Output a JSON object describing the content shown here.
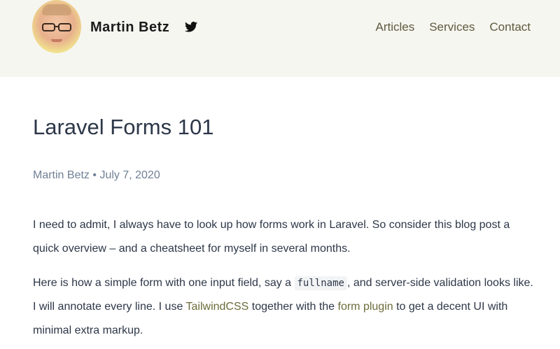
{
  "header": {
    "brand_name": "Martin Betz",
    "nav": [
      {
        "label": "Articles"
      },
      {
        "label": "Services"
      },
      {
        "label": "Contact"
      }
    ]
  },
  "article": {
    "title": "Laravel Forms 101",
    "author": "Martin Betz",
    "separator": "•",
    "date": "July 7, 2020",
    "paragraph1": "I need to admit, I always have to look up how forms work in Laravel. So consider this blog post a quick overview – and a cheatsheet for myself in several months.",
    "paragraph2": {
      "before_code": "Here is how a simple form with one input field, say a ",
      "code": "fullname",
      "after_code": ", and server-side validation looks like. I will annotate every line. I use ",
      "link1": "TailwindCSS",
      "between_links": " together with the ",
      "link2": "form plugin",
      "after_links": " to get a decent UI with minimal extra markup."
    }
  },
  "colors": {
    "header_bg": "#f6f6f0",
    "nav_link": "#5e5a3f",
    "accent_link": "#6b6c3a",
    "meta_text": "#718096"
  },
  "icons": {
    "twitter": "twitter-icon"
  }
}
